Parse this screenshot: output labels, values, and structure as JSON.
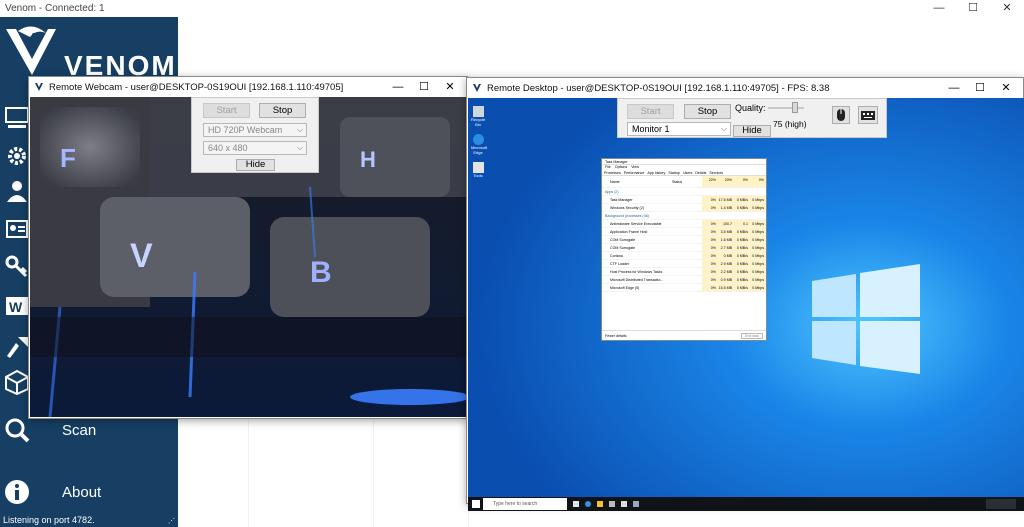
{
  "app": {
    "title": "Venom - Connected: 1",
    "logo_text": "VENOM",
    "window_controls": [
      "—",
      "☐",
      "✕"
    ],
    "status": "Listening on port 4782."
  },
  "sidebar": {
    "items": [
      {
        "label": "",
        "icon": "monitor-icon"
      },
      {
        "label": "",
        "icon": "gear-icon"
      },
      {
        "label": "",
        "icon": "user-icon"
      },
      {
        "label": "",
        "icon": "id-card-icon"
      },
      {
        "label": "",
        "icon": "key-icon"
      },
      {
        "label": "",
        "icon": "word-icon"
      },
      {
        "label": "",
        "icon": "tools-icon"
      },
      {
        "label": "",
        "icon": "package-icon"
      },
      {
        "label": "Scan",
        "icon": "magnifier-icon"
      },
      {
        "label": "About",
        "icon": "info-icon"
      }
    ]
  },
  "webcam_window": {
    "title": "Remote Webcam - user@DESKTOP-0S19OUI [192.168.1.110:49705]",
    "start_label": "Start",
    "stop_label": "Stop",
    "device": "HD 720P Webcam",
    "resolution": "640 x 480",
    "hide_label": "Hide",
    "keys": [
      "F",
      "H",
      "V",
      "B"
    ]
  },
  "desktop_window": {
    "title": "Remote Desktop - user@DESKTOP-0S19OUI [192.168.1.110:49705] - FPS: 8.38",
    "start_label": "Start",
    "stop_label": "Stop",
    "monitor": "Monitor 1",
    "hide_label": "Hide",
    "quality_label": "Quality:",
    "quality_value": "75 (high)",
    "quality_fraction": 0.75,
    "mouse_icon": "mouse-icon",
    "keyboard_icon": "keyboard-icon"
  },
  "remote_screen": {
    "desktop_icons": [
      "Recycle Bin",
      "Microsoft Edge",
      "Tools"
    ],
    "taskbar_search": "Type here to search",
    "task_manager": {
      "title": "Task Manager",
      "menu": [
        "File",
        "Options",
        "View"
      ],
      "tabs": [
        "Processes",
        "Performance",
        "App history",
        "Startup",
        "Users",
        "Details",
        "Services"
      ],
      "columns": [
        "Name",
        "Status",
        "CPU",
        "Memory",
        "Disk",
        "Network"
      ],
      "col_pct": [
        "22%",
        "20%",
        "0%",
        "0%"
      ],
      "groups": [
        "Apps (2)",
        "Background processes (46)"
      ],
      "apps": [
        {
          "name": "Task Manager",
          "cpu": "0%",
          "mem": "17.5 MB",
          "disk": "0 MB/s",
          "net": "0 Mbps"
        },
        {
          "name": "Windows Security (2)",
          "cpu": "0%",
          "mem": "1.4 MB",
          "disk": "0 MB/s",
          "net": "0 Mbps"
        }
      ],
      "bg": [
        {
          "name": "Antimalware Service Executable",
          "cpu": "0%",
          "mem": "100.7 MB",
          "disk": "0.1 MB/s",
          "net": "0 Mbps"
        },
        {
          "name": "Application Frame Host",
          "cpu": "0%",
          "mem": "3.5 MB",
          "disk": "0 MB/s",
          "net": "0 Mbps"
        },
        {
          "name": "COM Surrogate",
          "cpu": "0%",
          "mem": "1.6 MB",
          "disk": "0 MB/s",
          "net": "0 Mbps"
        },
        {
          "name": "COM Surrogate",
          "cpu": "0%",
          "mem": "2.7 MB",
          "disk": "0 MB/s",
          "net": "0 Mbps"
        },
        {
          "name": "Cortana",
          "cpu": "0%",
          "mem": "0 MB",
          "disk": "0 MB/s",
          "net": "0 Mbps"
        },
        {
          "name": "CTF Loader",
          "cpu": "0%",
          "mem": "2.9 MB",
          "disk": "0 MB/s",
          "net": "0 Mbps"
        },
        {
          "name": "Host Process for Windows Tasks",
          "cpu": "0%",
          "mem": "2.2 MB",
          "disk": "0 MB/s",
          "net": "0 Mbps"
        },
        {
          "name": "Microsoft Distributed Transactio...",
          "cpu": "0%",
          "mem": "0.9 MB",
          "disk": "0 MB/s",
          "net": "0 Mbps"
        },
        {
          "name": "Microsoft Edge (5)",
          "cpu": "0%",
          "mem": "15.5 MB",
          "disk": "0 MB/s",
          "net": "0 Mbps"
        }
      ],
      "fewer": "Fewer details",
      "end_task": "End task"
    }
  },
  "colors": {
    "sidebar": "#163f63",
    "win10_blue": "#0a5fc4",
    "cam_glow": "#3a7dff"
  }
}
